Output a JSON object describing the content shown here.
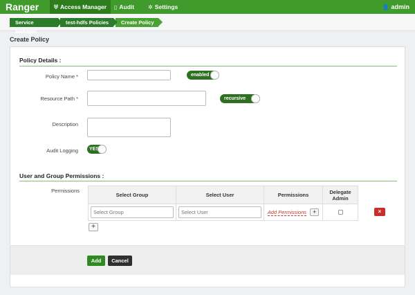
{
  "nav": {
    "brand": "Ranger",
    "items": [
      {
        "label": "Access Manager",
        "icon": "shield-icon",
        "glyph": "⛨"
      },
      {
        "label": "Audit",
        "icon": "document-icon",
        "glyph": "▯"
      },
      {
        "label": "Settings",
        "icon": "gear-icon",
        "glyph": "✲"
      }
    ],
    "user": {
      "label": "admin",
      "icon": "user-icon",
      "glyph": "👤"
    }
  },
  "breadcrumb": [
    "Service Manager",
    "test-hdfs Policies",
    "Create Policy"
  ],
  "page_title": "Create Policy",
  "policy_details": {
    "title": "Policy Details :",
    "policy_name_label": "Policy Name *",
    "policy_name_value": "",
    "enabled_toggle": "enabled",
    "resource_path_label": "Resource Path *",
    "resource_path_value": "",
    "recursive_toggle": "recursive",
    "description_label": "Description",
    "description_value": "",
    "audit_logging_label": "Audit Logging",
    "audit_logging_toggle": "YES"
  },
  "permissions_section": {
    "title": "User and Group Permissions :",
    "permissions_label": "Permissions",
    "columns": [
      "Select Group",
      "Select User",
      "Permissions",
      "Delegate Admin"
    ],
    "row": {
      "group_placeholder": "Select Group",
      "user_placeholder": "Select User",
      "add_permissions": "Add Permissions",
      "plus": "+",
      "delete": "×"
    },
    "add_row": "+"
  },
  "actions": {
    "add": "Add",
    "cancel": "Cancel"
  },
  "colors": {
    "accent": "#409a2c",
    "danger": "#c9302c",
    "dark_button": "#2f2f2f"
  }
}
